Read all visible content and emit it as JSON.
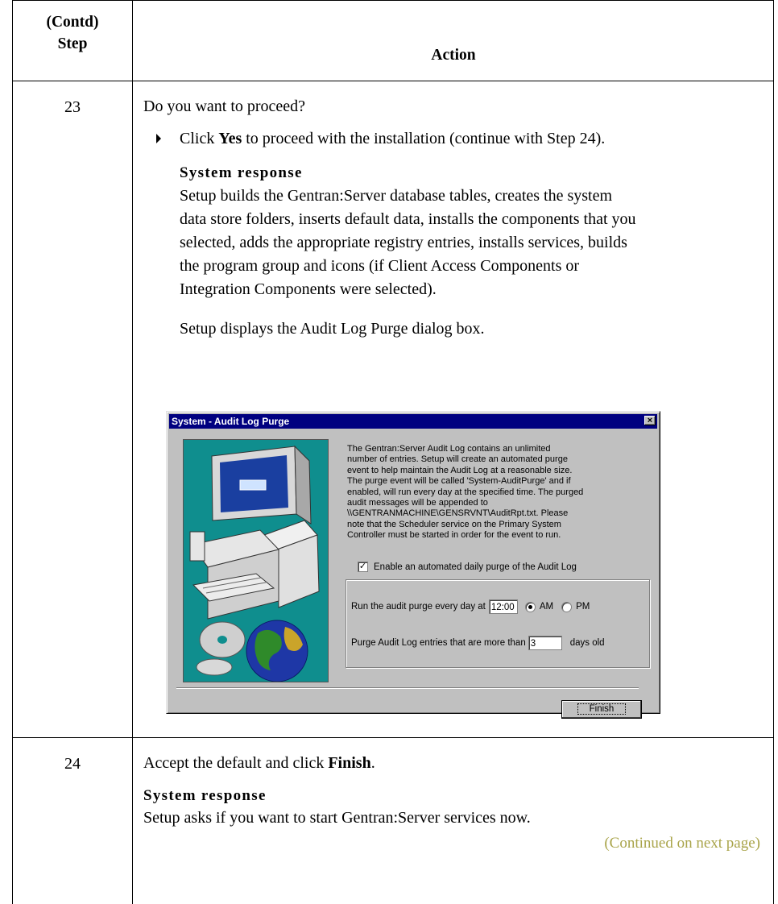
{
  "table": {
    "header": {
      "step_line1": "(Contd)",
      "step_line2": "Step",
      "action": "Action"
    },
    "row23": {
      "step": "23",
      "question": "Do you want to proceed?",
      "bullet_pre": "Click ",
      "bullet_bold": "Yes",
      "bullet_post": " to proceed with the installation (continue with Step 24).",
      "system_response_heading": "System response",
      "response_lines": [
        "Setup builds the Gentran:Server database tables, creates the system",
        "data store folders, inserts default data, installs the components that you",
        "selected, adds the appropriate registry entries, installs services, builds",
        "the program group and icons (if Client Access Components or",
        "Integration Components were selected)."
      ],
      "displays_text": "Setup displays the Audit Log Purge dialog box."
    },
    "row24": {
      "step": "24",
      "text_pre": "Accept the default and click ",
      "text_bold": "Finish",
      "text_post": ".",
      "system_response_heading": "System response",
      "response": "Setup asks if you want to start Gentran:Server services now."
    },
    "continued": "(Continued on next page)"
  },
  "dialog": {
    "title": "System - Audit Log Purge",
    "close_glyph": "×",
    "description_lines": [
      "The Gentran:Server Audit Log contains an unlimited",
      "number of entries.  Setup will create an automated purge",
      "event to help maintain the Audit Log at a reasonable size.",
      "The purge event will be called 'System-AuditPurge' and if",
      "enabled, will run every day at the specified time.  The purged",
      "audit messages will be appended to",
      "\\\\GENTRANMACHINE\\GENSRVNT\\AuditRpt.txt. Please",
      "note that the Scheduler service on the Primary System",
      "Controller must be started in order for the event to run."
    ],
    "enable_checkbox": {
      "label": "Enable an automated daily purge of the Audit Log",
      "checked": true,
      "mark": "✓"
    },
    "run_label": "Run the audit purge every day at",
    "run_time": "12:00",
    "am_label": "AM",
    "pm_label": "PM",
    "selected_period": "AM",
    "purge_label": "Purge Audit Log entries that are more than",
    "purge_days": "3",
    "days_old_label": "days old",
    "finish_label": "Finish",
    "colors": {
      "title_bar": "#000080",
      "face": "#c0c0c0",
      "picture_bg": "#0f8e8e"
    }
  }
}
